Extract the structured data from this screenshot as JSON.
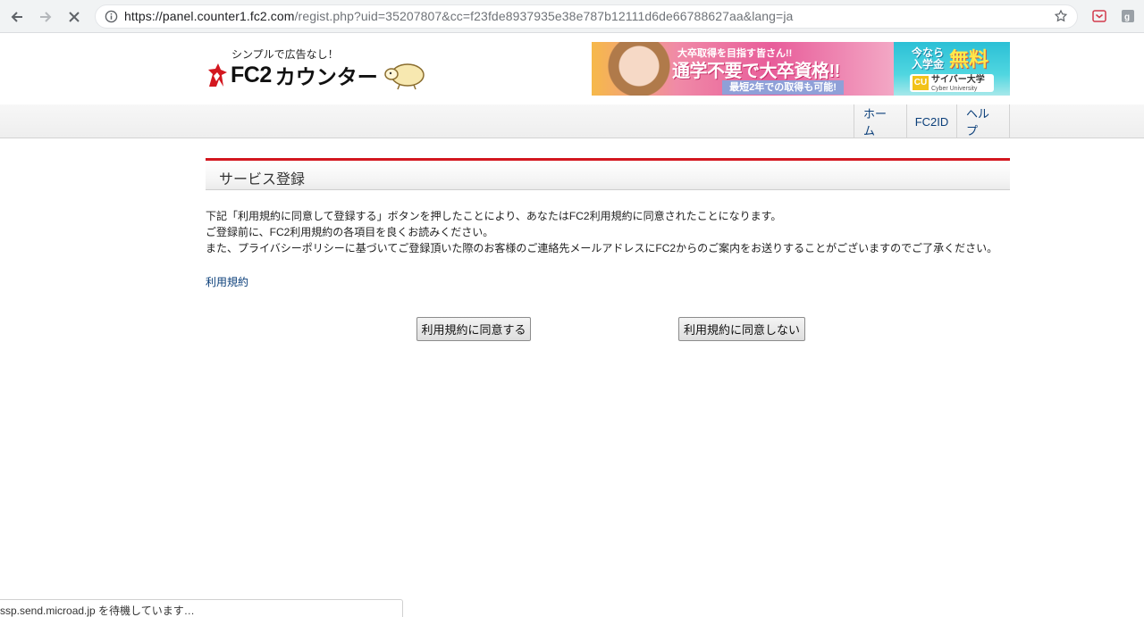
{
  "browser": {
    "url_host": "https://panel.counter1.fc2.com",
    "url_rest": "/regist.php?uid=35207807&cc=f23fde8937935e38e787b12111d6de66788627aa&lang=ja",
    "status_text": "ssp.send.microad.jp を待機しています…"
  },
  "header": {
    "tagline": "シンプルで広告なし！",
    "logo_text": "FC2",
    "logo_kana": "カウンター"
  },
  "ad": {
    "copy1": "大卒取得を目指す皆さん!!",
    "copy2": "通学不要で大卒資格!!",
    "copy3": "最短2年での取得も可能!",
    "right1": "今なら入学金",
    "right2": "無料",
    "right3": "サイバー大学",
    "right3_sub": "Cyber University",
    "right3_badge": "CU"
  },
  "nav": {
    "home": "ホーム",
    "fc2id": "FC2ID",
    "help": "ヘルプ"
  },
  "main": {
    "title": "サービス登録",
    "desc_lines": [
      "下記「利用規約に同意して登録する」ボタンを押したことにより、あなたはFC2利用規約に同意されたことになります。",
      "ご登録前に、FC2利用規約の各項目を良くお読みください。",
      "また、プライバシーポリシーに基づいてご登録頂いた際のお客様のご連絡先メールアドレスにFC2からのご案内をお送りすることがございますのでご了承ください。"
    ],
    "terms_link": "利用規約",
    "agree_button": "利用規約に同意する",
    "disagree_button": "利用規約に同意しない"
  },
  "colors": {
    "accent_red": "#d3171f",
    "link_blue": "#0b3f7a"
  }
}
